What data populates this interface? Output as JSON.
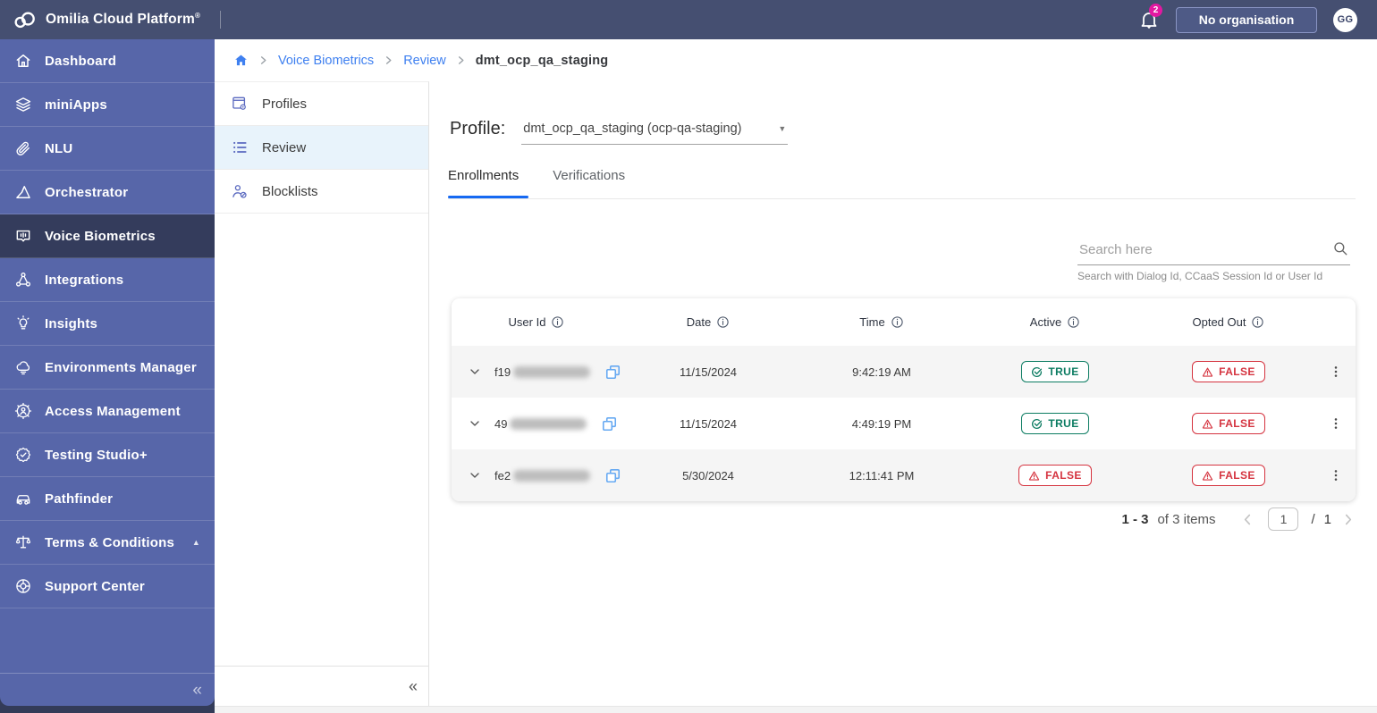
{
  "app": {
    "title": "Omilia Cloud Platform",
    "registered_mark": "®"
  },
  "topbar": {
    "notifications_count": "2",
    "org_button_label": "No organisation",
    "avatar_initials": "GG"
  },
  "sidebar": {
    "items": [
      {
        "label": "Dashboard",
        "icon": "home-icon",
        "active": false
      },
      {
        "label": "miniApps",
        "icon": "layers-icon",
        "active": false
      },
      {
        "label": "NLU",
        "icon": "paperclip-icon",
        "active": false
      },
      {
        "label": "Orchestrator",
        "icon": "triangle-icon",
        "active": false
      },
      {
        "label": "Voice Biometrics",
        "icon": "chat-wave-icon",
        "active": true
      },
      {
        "label": "Integrations",
        "icon": "network-icon",
        "active": false
      },
      {
        "label": "Insights",
        "icon": "lightbulb-icon",
        "active": false
      },
      {
        "label": "Environments Manager",
        "icon": "cloud-icon",
        "active": false
      },
      {
        "label": "Access Management",
        "icon": "gear-user-icon",
        "active": false
      },
      {
        "label": "Testing Studio+",
        "icon": "badge-check-icon",
        "active": false
      },
      {
        "label": "Pathfinder",
        "icon": "car-icon",
        "active": false
      },
      {
        "label": "Terms & Conditions",
        "icon": "scales-icon",
        "active": false,
        "has_caret": true
      },
      {
        "label": "Support Center",
        "icon": "lifebuoy-icon",
        "active": false
      }
    ],
    "collapse_glyph": "«"
  },
  "breadcrumb": {
    "links": [
      "Voice Biometrics",
      "Review"
    ],
    "current": "dmt_ocp_qa_staging"
  },
  "subsidebar": {
    "items": [
      {
        "label": "Profiles",
        "icon": "window-gear-icon",
        "active": false
      },
      {
        "label": "Review",
        "icon": "list-icon",
        "active": true
      },
      {
        "label": "Blocklists",
        "icon": "user-slash-icon",
        "active": false
      }
    ],
    "collapse_glyph": "«"
  },
  "main": {
    "profile_label": "Profile:",
    "profile_value": "dmt_ocp_qa_staging (ocp-qa-staging)",
    "tabs": [
      {
        "label": "Enrollments",
        "active": true
      },
      {
        "label": "Verifications",
        "active": false
      }
    ],
    "search": {
      "placeholder": "Search here",
      "helper": "Search with Dialog Id, CCaaS Session Id or User Id"
    },
    "table": {
      "columns": [
        "User Id",
        "Date",
        "Time",
        "Active",
        "Opted Out"
      ],
      "rows": [
        {
          "user_id_prefix": "f19",
          "user_id_redacted": true,
          "date": "11/15/2024",
          "time": "9:42:19 AM",
          "active": "TRUE",
          "opted_out": "FALSE"
        },
        {
          "user_id_prefix": "49",
          "user_id_redacted": true,
          "date": "11/15/2024",
          "time": "4:49:19 PM",
          "active": "TRUE",
          "opted_out": "FALSE"
        },
        {
          "user_id_prefix": "fe2",
          "user_id_redacted": true,
          "date": "5/30/2024",
          "time": "12:11:41 PM",
          "active": "FALSE",
          "opted_out": "FALSE"
        }
      ]
    },
    "pagination": {
      "range": "1 - 3",
      "of_text": "of 3 items",
      "page_input": "1",
      "separator": "/",
      "total_pages": "1"
    }
  },
  "colors": {
    "topbar": "#454f71",
    "sidebar": "#5766a9",
    "sidebar_active": "#343c5c",
    "subsidebar_active": "#e8f3fb",
    "link_blue": "#3f80f0",
    "tab_accent": "#1669f2",
    "badge_green": "#0c7c62",
    "badge_red": "#d5333f",
    "notification_pink": "#e318a1",
    "row_alt_gray": "#f5f5f5"
  }
}
